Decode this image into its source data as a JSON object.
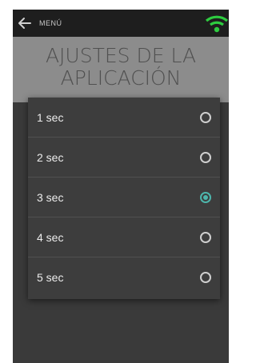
{
  "topbar": {
    "menu_label": "MENÚ",
    "back_icon": "arrow-left-icon",
    "wifi_icon": "wifi-icon",
    "wifi_color": "#2ecc40"
  },
  "header": {
    "title": "AJUSTES DE LA\nAPLICACIÓN"
  },
  "dialog": {
    "accent_color": "#4db6ac",
    "options": [
      {
        "label": "1 sec",
        "selected": false
      },
      {
        "label": "2 sec",
        "selected": false
      },
      {
        "label": "3 sec",
        "selected": true
      },
      {
        "label": "4 sec",
        "selected": false
      },
      {
        "label": "5 sec",
        "selected": false
      }
    ]
  }
}
